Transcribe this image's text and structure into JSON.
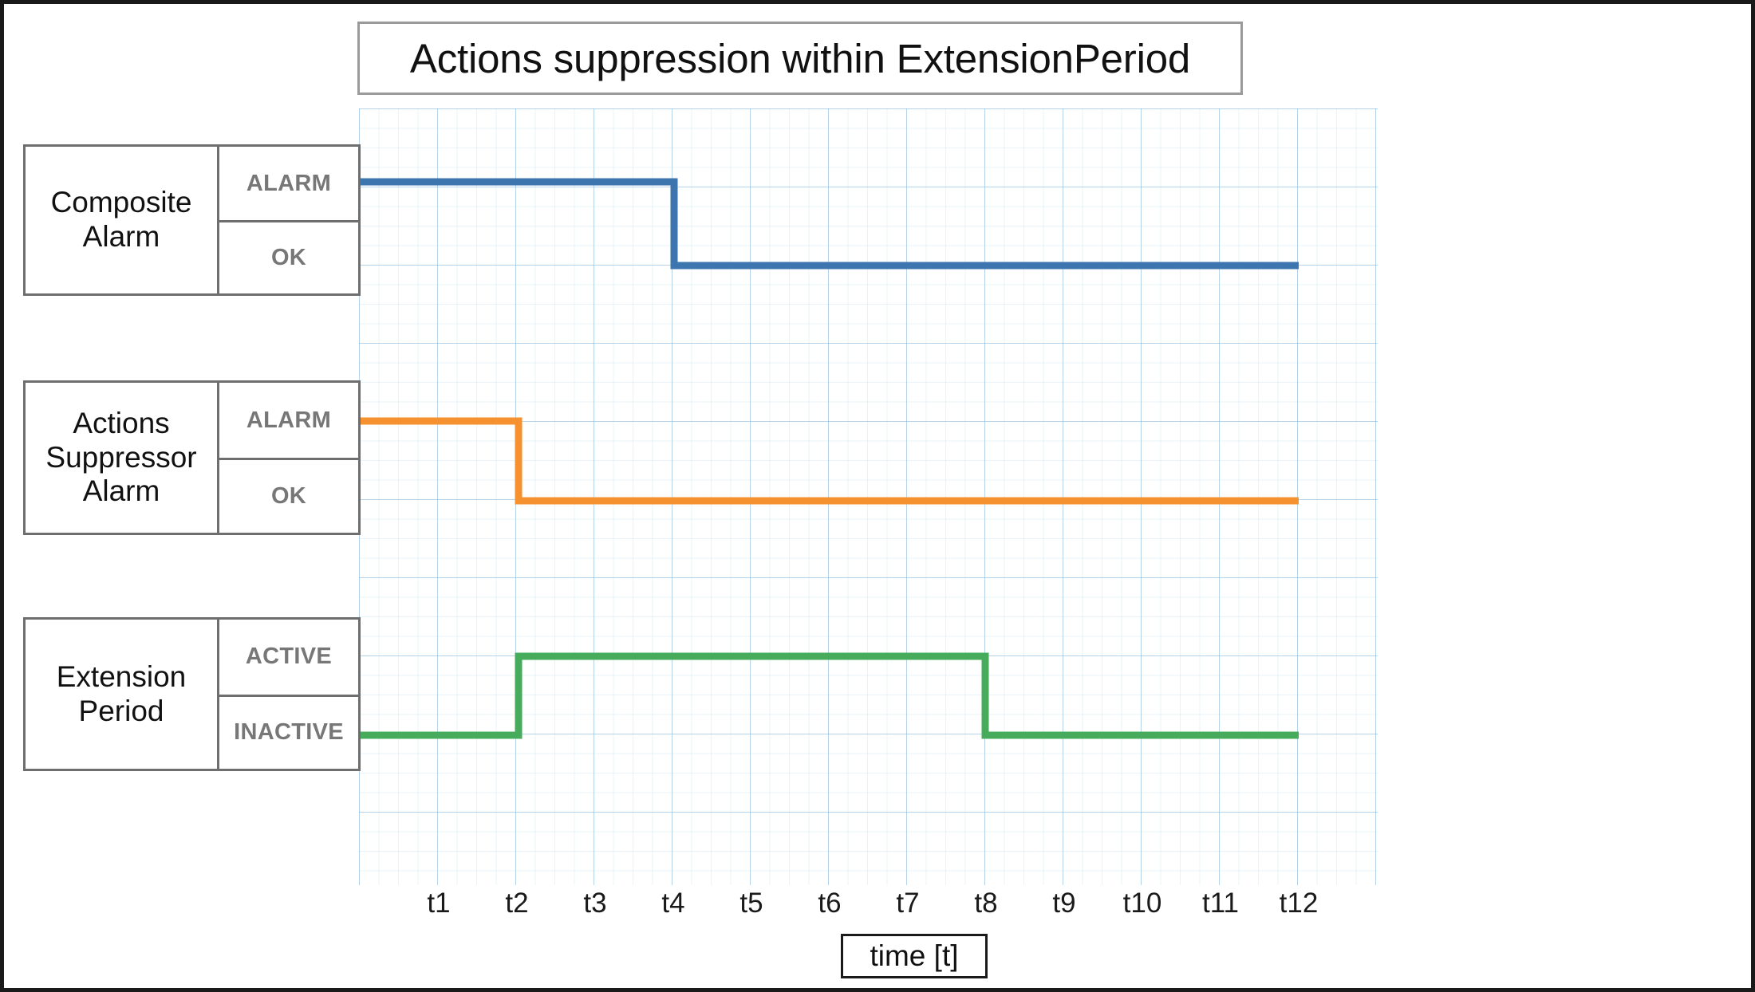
{
  "title": "Actions suppression within ExtensionPeriod",
  "axis": {
    "x_label": "time [t]",
    "ticks": [
      "t1",
      "t2",
      "t3",
      "t4",
      "t5",
      "t6",
      "t7",
      "t8",
      "t9",
      "t10",
      "t11",
      "t12"
    ]
  },
  "legend": {
    "composite": {
      "name": "Composite\nAlarm",
      "state_high": "ALARM",
      "state_low": "OK"
    },
    "suppressor": {
      "name": "Actions\nSuppressor\nAlarm",
      "state_high": "ALARM",
      "state_low": "OK"
    },
    "extension": {
      "name": "Extension\nPeriod",
      "state_high": "ACTIVE",
      "state_low": "INACTIVE"
    }
  },
  "colors": {
    "composite_alarm": "#3D76AF",
    "actions_suppressor_alarm": "#F5912E",
    "extension_period": "#46AC5B",
    "grid": "#D6E7F2",
    "border": "#1A1A1A",
    "box_border": "#6E6E6E",
    "state_text": "#777777"
  },
  "chart_data": {
    "type": "line",
    "title": "Actions suppression within ExtensionPeriod",
    "xlabel": "time [t]",
    "ylabel": "",
    "grid": true,
    "legend_position": "left",
    "x_ticks": [
      "t1",
      "t2",
      "t3",
      "t4",
      "t5",
      "t6",
      "t7",
      "t8",
      "t9",
      "t10",
      "t11",
      "t12"
    ],
    "xlim": [
      "t0",
      "t12"
    ],
    "note": "Step (digital state) timing diagram. Each series holds a discrete state and switches at the listed times.",
    "series": [
      {
        "name": "Composite Alarm",
        "color": "#3D76AF",
        "states": [
          "ALARM",
          "OK"
        ],
        "step": "post",
        "transitions": [
          {
            "time": "t0",
            "state": "ALARM"
          },
          {
            "time": "t4",
            "state": "OK"
          }
        ],
        "x": [
          "t0",
          "t4",
          "t4",
          "t12"
        ],
        "y": [
          "ALARM",
          "ALARM",
          "OK",
          "OK"
        ]
      },
      {
        "name": "Actions Suppressor Alarm",
        "color": "#F5912E",
        "states": [
          "ALARM",
          "OK"
        ],
        "step": "post",
        "transitions": [
          {
            "time": "t0",
            "state": "ALARM"
          },
          {
            "time": "t2",
            "state": "OK"
          }
        ],
        "x": [
          "t0",
          "t2",
          "t2",
          "t12"
        ],
        "y": [
          "ALARM",
          "ALARM",
          "OK",
          "OK"
        ]
      },
      {
        "name": "Extension Period",
        "color": "#46AC5B",
        "states": [
          "ACTIVE",
          "INACTIVE"
        ],
        "step": "post",
        "transitions": [
          {
            "time": "t0",
            "state": "INACTIVE"
          },
          {
            "time": "t2",
            "state": "ACTIVE"
          },
          {
            "time": "t8",
            "state": "INACTIVE"
          }
        ],
        "x": [
          "t0",
          "t2",
          "t2",
          "t8",
          "t8",
          "t12"
        ],
        "y": [
          "INACTIVE",
          "INACTIVE",
          "ACTIVE",
          "ACTIVE",
          "INACTIVE",
          "INACTIVE"
        ]
      }
    ]
  }
}
